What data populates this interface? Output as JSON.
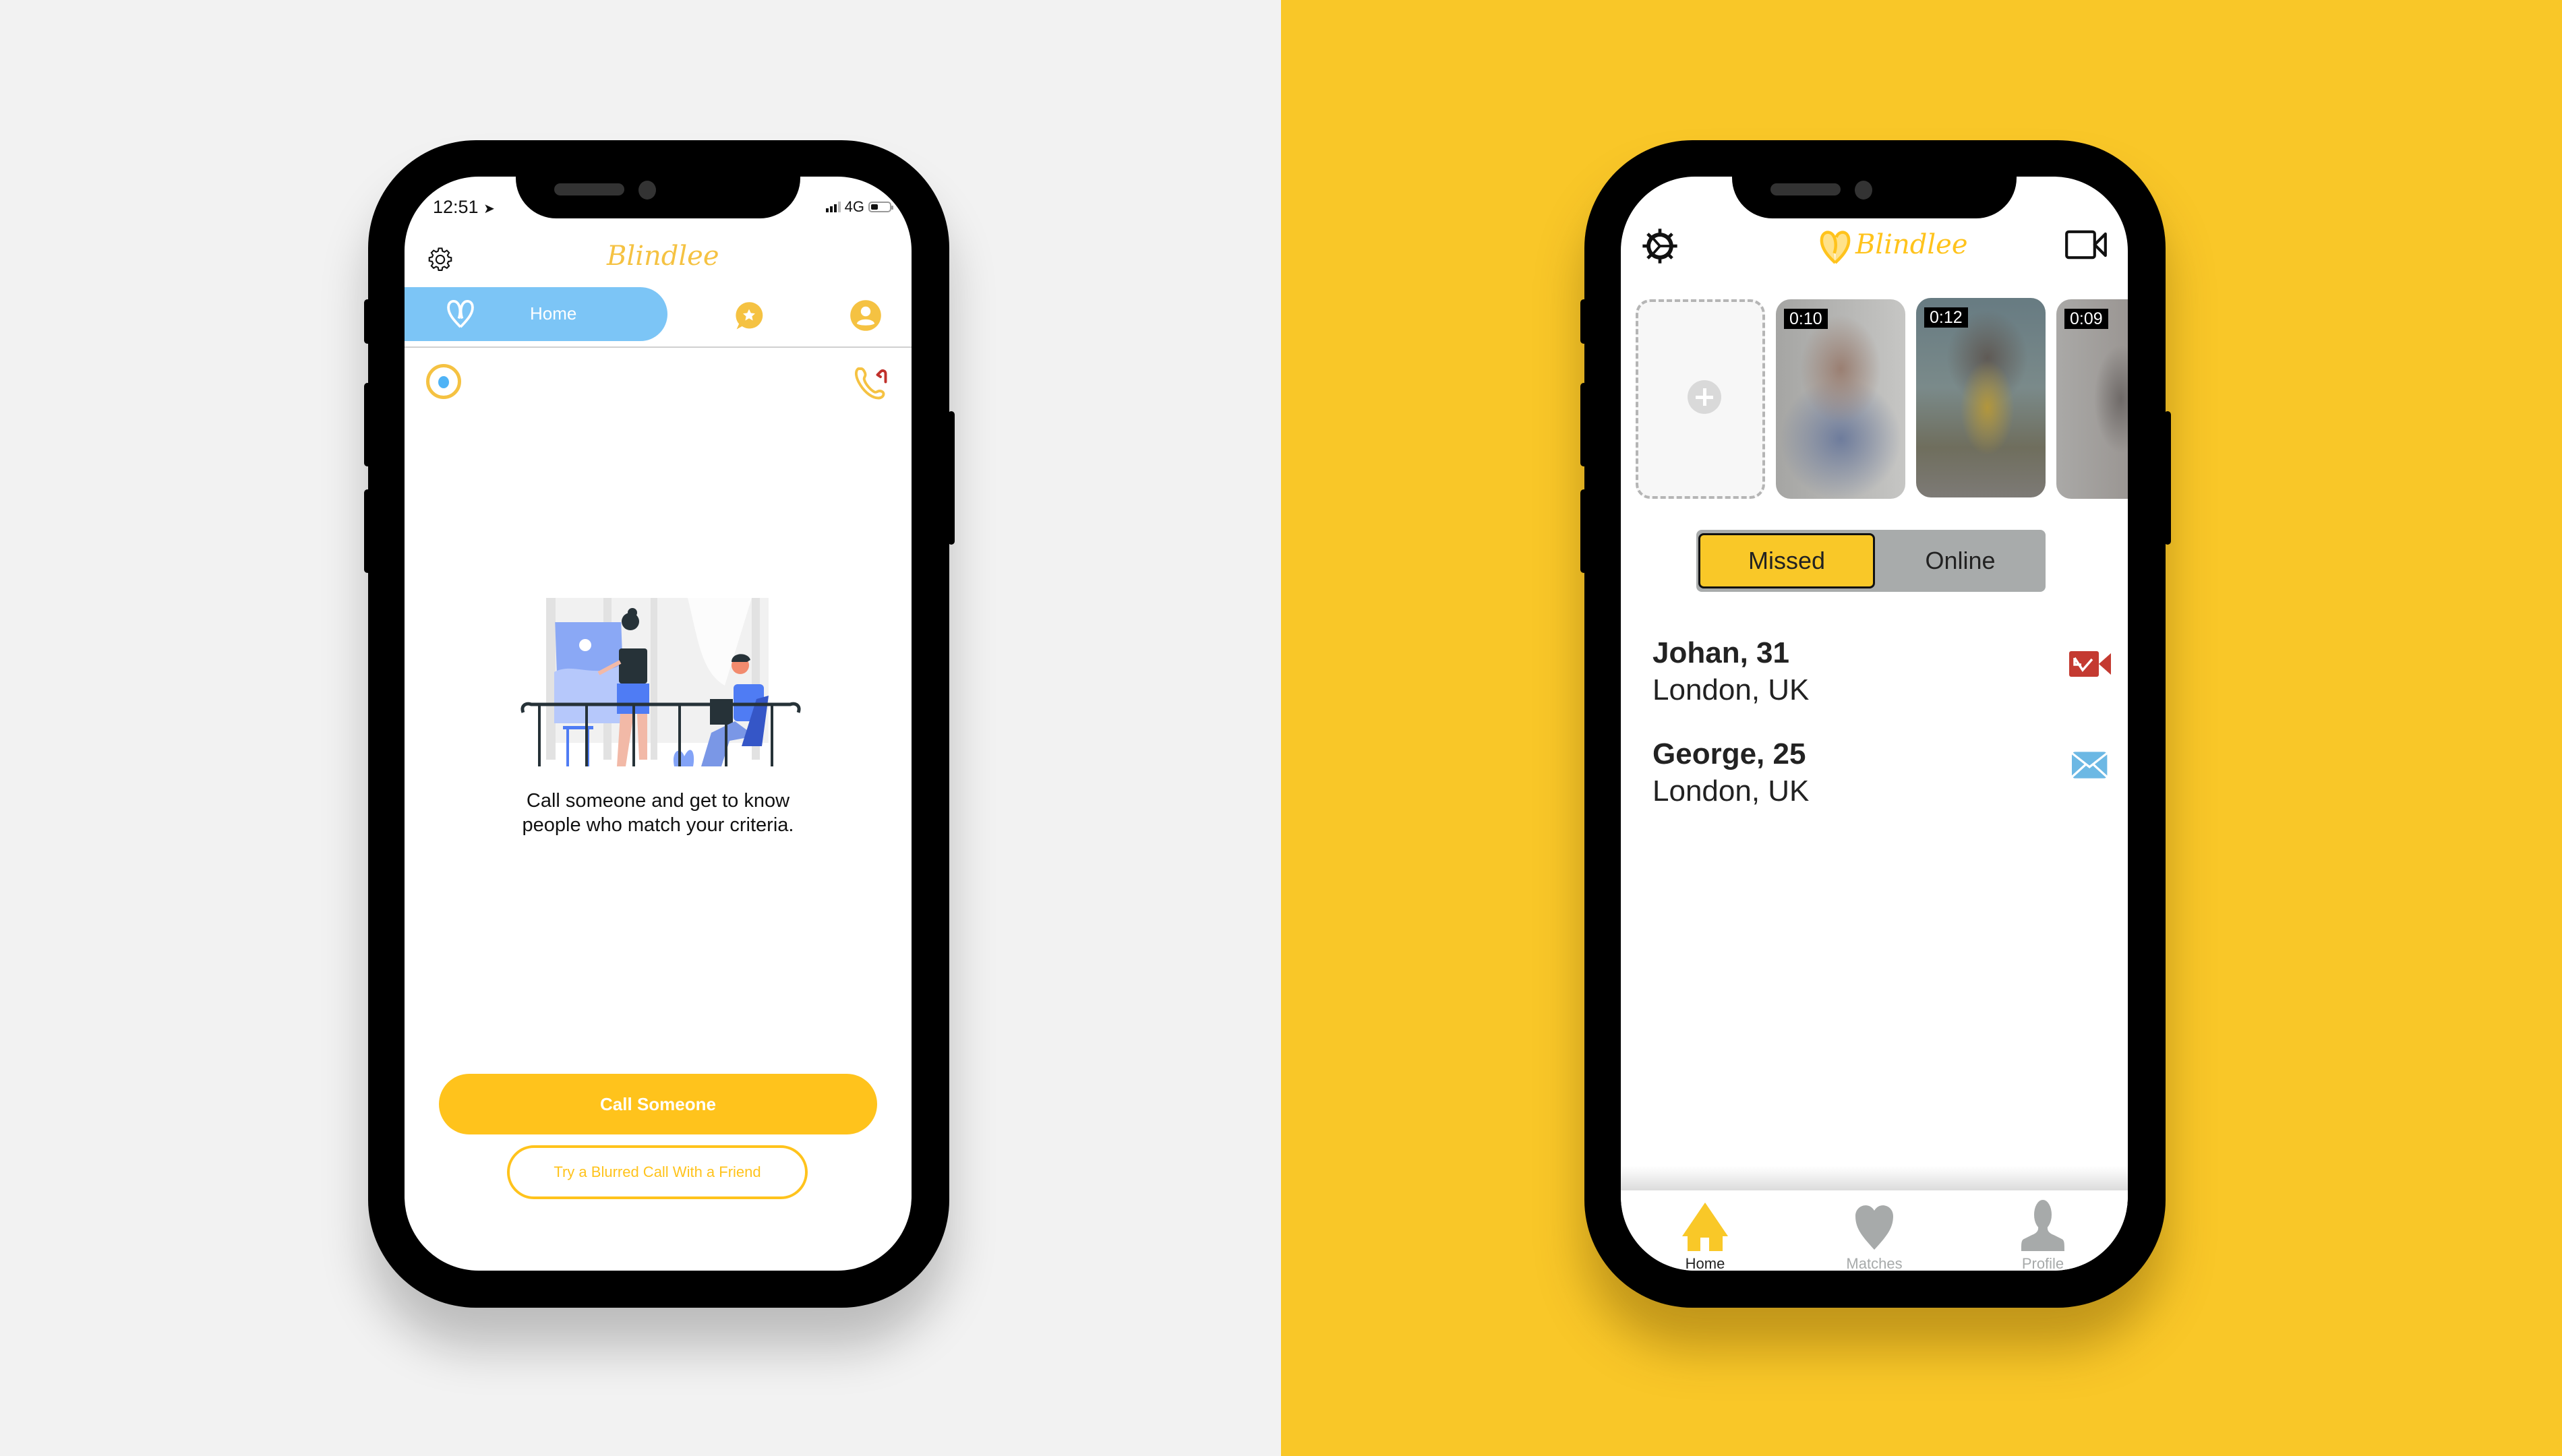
{
  "left_phone": {
    "status_bar": {
      "time": "12:51",
      "network": "4G",
      "battery_fill": 0.4
    },
    "header": {
      "logo_text": "Blindlee"
    },
    "tabs": [
      {
        "label": "Home",
        "icon": "heart-logo-icon",
        "active": true
      },
      {
        "label": "",
        "icon": "chat-star-icon",
        "active": false
      },
      {
        "label": "",
        "icon": "user-circle-icon",
        "active": false
      }
    ],
    "message_line1": "Call someone and get to know",
    "message_line2": "people who match your criteria.",
    "call_button": "Call Someone",
    "blurred_call_button": "Try a Blurred Call With a Friend",
    "colors": {
      "accent": "#ffc31c",
      "tab_active": "#7cc5f6",
      "radio_dot": "#4fb3f6",
      "callback_arrow": "#c0302b"
    }
  },
  "right_phone": {
    "header": {
      "logo_text": "Blindlee"
    },
    "thumbnails": [
      {
        "type": "add"
      },
      {
        "type": "video",
        "duration": "0:10"
      },
      {
        "type": "video",
        "duration": "0:12"
      },
      {
        "type": "video",
        "duration": "0:09"
      }
    ],
    "segmented": {
      "options": [
        "Missed",
        "Online"
      ],
      "selected": "Missed"
    },
    "list": [
      {
        "name": "Johan, 31",
        "location": "London, UK",
        "icon": "missed-video-call-icon",
        "icon_color": "#c43a31"
      },
      {
        "name": "George, 25",
        "location": "London, UK",
        "icon": "mail-icon",
        "icon_color": "#6cb8e4"
      }
    ],
    "bottom_nav": [
      {
        "label": "Home",
        "icon": "home-icon",
        "active": true
      },
      {
        "label": "Matches",
        "icon": "heart-icon",
        "active": false
      },
      {
        "label": "Profile",
        "icon": "profile-icon",
        "active": false
      }
    ],
    "colors": {
      "accent": "#f9c828",
      "inactive": "#a7aaaa"
    }
  },
  "backgrounds": {
    "left": "#f2f2f2",
    "right": "#f9c728"
  }
}
